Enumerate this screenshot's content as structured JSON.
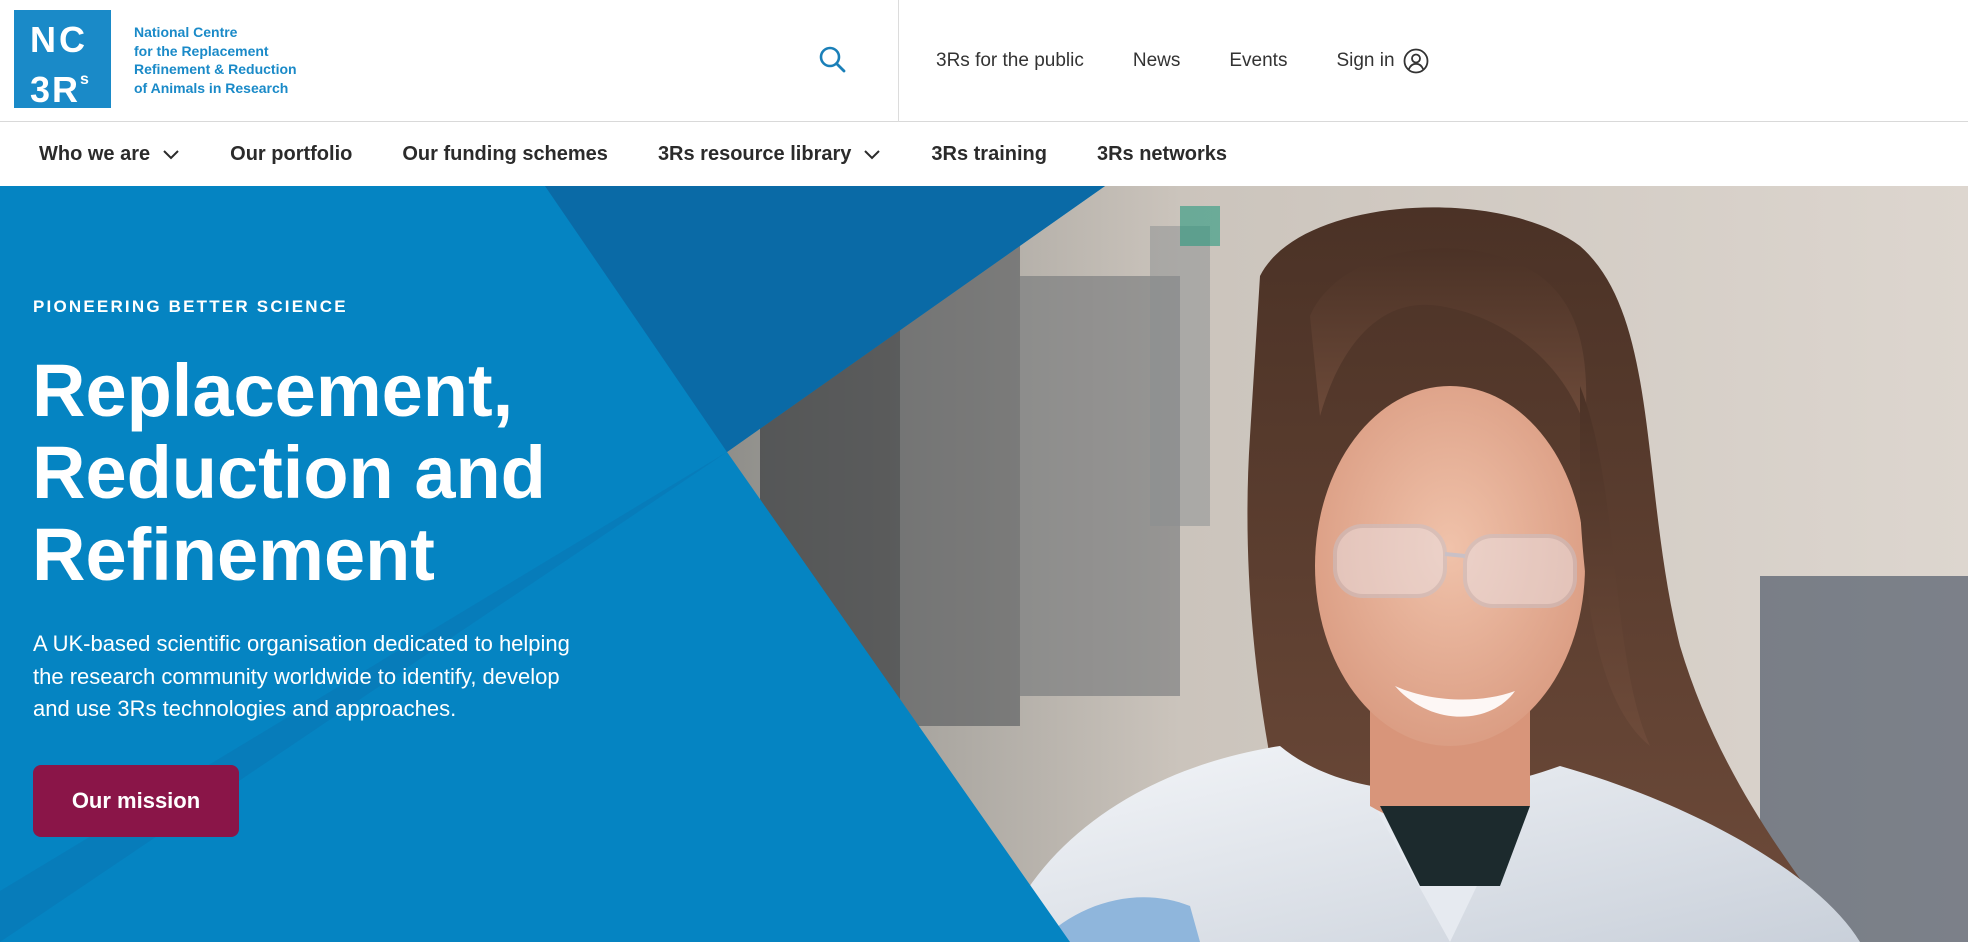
{
  "brand": {
    "logo_line1": "NC",
    "logo_line2": "3R",
    "logo_sup": "s",
    "name_lines": [
      "National Centre",
      "for the Replacement",
      "Refinement & Reduction",
      "of Animals in Research"
    ],
    "color": "#1a8ac8"
  },
  "utility_nav": {
    "items": [
      "3Rs for the public",
      "News",
      "Events"
    ],
    "sign_in_label": "Sign in"
  },
  "main_nav": {
    "items": [
      {
        "label": "Who we are",
        "has_dropdown": true
      },
      {
        "label": "Our portfolio",
        "has_dropdown": false
      },
      {
        "label": "Our funding schemes",
        "has_dropdown": false
      },
      {
        "label": "3Rs resource library",
        "has_dropdown": true
      },
      {
        "label": "3Rs training",
        "has_dropdown": false
      },
      {
        "label": "3Rs networks",
        "has_dropdown": false
      }
    ]
  },
  "hero": {
    "eyebrow": "PIONEERING BETTER SCIENCE",
    "title_lines": [
      "Replacement,",
      "Reduction and",
      "Refinement"
    ],
    "description": "A UK-based scientific organisation dedicated to helping the research community worldwide to identify, develop and use 3Rs technologies and approaches.",
    "cta_label": "Our mission",
    "colors": {
      "primary_blue": "#0584c2",
      "dark_blue": "#0a6aa6",
      "cta": "#8a1548"
    }
  },
  "icons": {
    "search": "search-icon",
    "user": "user-circle-icon",
    "dropdown": "chevron-down-icon"
  }
}
